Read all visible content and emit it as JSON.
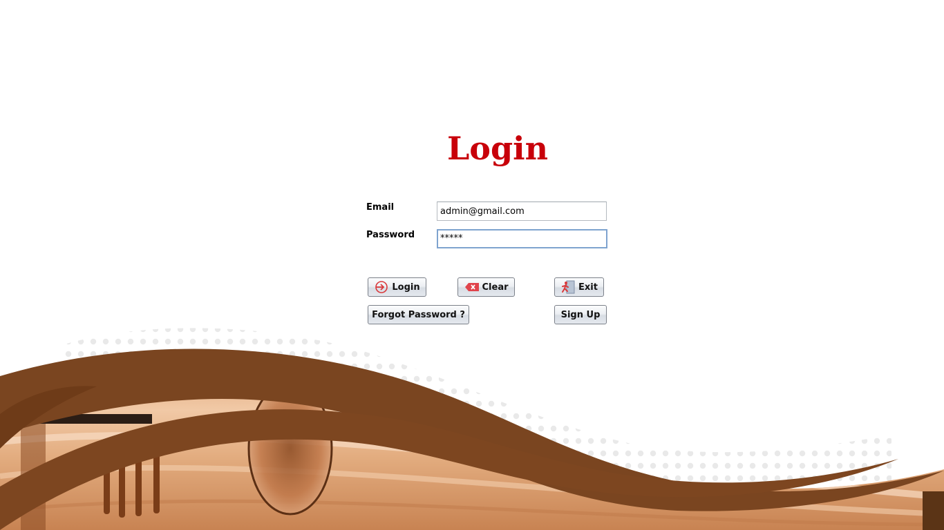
{
  "form": {
    "title": "Login",
    "email_label": "Email",
    "email_value": "admin@gmail.com",
    "password_label": "Password",
    "password_value": "*****"
  },
  "buttons": {
    "login": "Login",
    "clear": "Clear",
    "exit": "Exit",
    "forgot_password": "Forgot Password ?",
    "sign_up": "Sign Up"
  },
  "icons": {
    "login": "login-arrow-icon",
    "clear": "clear-tag-icon",
    "exit": "exit-door-icon"
  },
  "colors": {
    "title": "#c8000a",
    "wave_dark_brown": "#7a4520",
    "wood_light": "#e6b48c",
    "field_focus_border": "#7ea3cf"
  }
}
